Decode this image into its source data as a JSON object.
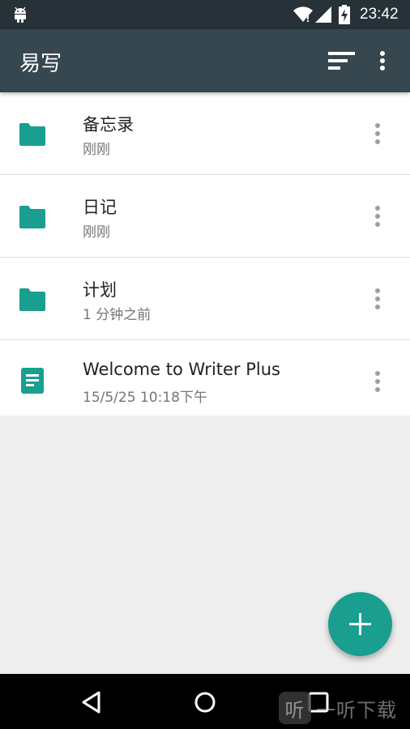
{
  "status_bar": {
    "time": "23:42",
    "icons": [
      "android-icon",
      "wifi-icon",
      "signal-icon",
      "battery-charging-icon"
    ]
  },
  "app_bar": {
    "title": "易写",
    "actions": [
      "sort-icon",
      "more-vert-icon"
    ]
  },
  "items": [
    {
      "type": "folder",
      "icon": "folder-icon",
      "title": "备忘录",
      "subtitle": "刚刚"
    },
    {
      "type": "folder",
      "icon": "folder-icon",
      "title": "日记",
      "subtitle": "刚刚"
    },
    {
      "type": "folder",
      "icon": "folder-icon",
      "title": "计划",
      "subtitle": "1 分钟之前"
    },
    {
      "type": "document",
      "icon": "document-icon",
      "title": "Welcome to Writer Plus",
      "subtitle": "15/5/25 10:18下午"
    }
  ],
  "fab": {
    "icon": "plus-icon"
  },
  "nav_bar": {
    "buttons": [
      "back-icon",
      "home-icon",
      "recents-icon"
    ]
  },
  "watermark": {
    "logo": "听",
    "text": "一听下载"
  },
  "colors": {
    "status_bar": "#263238",
    "app_bar": "#37474f",
    "accent": "#1a9e90",
    "background": "#eeeeee"
  }
}
